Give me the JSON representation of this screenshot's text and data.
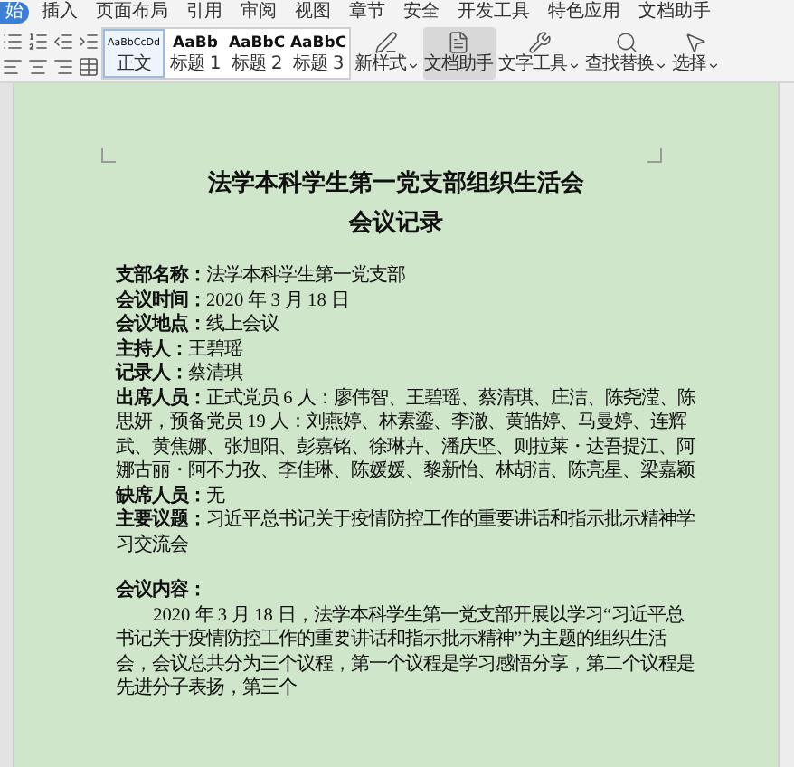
{
  "menu_tabs": [
    {
      "label": "始",
      "selected": true
    },
    {
      "label": "插入",
      "selected": false
    },
    {
      "label": "页面布局",
      "selected": false
    },
    {
      "label": "引用",
      "selected": false
    },
    {
      "label": "审阅",
      "selected": false
    },
    {
      "label": "视图",
      "selected": false
    },
    {
      "label": "章节",
      "selected": false
    },
    {
      "label": "安全",
      "selected": false
    },
    {
      "label": "开发工具",
      "selected": false
    },
    {
      "label": "特色应用",
      "selected": false
    },
    {
      "label": "文档助手",
      "selected": false
    }
  ],
  "styles": [
    {
      "sample": "AaBbCcDd",
      "label": "正文",
      "selected": true
    },
    {
      "sample": "AaBb",
      "label": "标题 1",
      "selected": false
    },
    {
      "sample": "AaBbC",
      "label": "标题 2",
      "selected": false
    },
    {
      "sample": "AaBbC",
      "label": "标题 3",
      "selected": false
    }
  ],
  "tools": [
    {
      "kind": "new-style",
      "label": "新样式",
      "dropdown": true,
      "selected": false
    },
    {
      "kind": "assistant",
      "label": "文档助手",
      "dropdown": false,
      "selected": true
    },
    {
      "kind": "text-tools",
      "label": "文字工具",
      "dropdown": true,
      "selected": false
    },
    {
      "kind": "find",
      "label": "查找替换",
      "dropdown": true,
      "selected": false
    },
    {
      "kind": "select",
      "label": "选择",
      "dropdown": true,
      "selected": false
    }
  ],
  "document": {
    "title": "法学本科学生第一党支部组织生活会",
    "subtitle": "会议记录",
    "fields": [
      {
        "label": "支部名称：",
        "value": "法学本科学生第一党支部"
      },
      {
        "label": "会议时间：",
        "value": "2020 年 3 月 18 日"
      },
      {
        "label": "会议地点：",
        "value": "线上会议"
      },
      {
        "label": "主持人：",
        "value": "王碧瑶"
      },
      {
        "label": "记录人：",
        "value": "蔡清琪"
      },
      {
        "label": "出席人员：",
        "value": "正式党员 6 人：廖伟智、王碧瑶、蔡清琪、庄洁、陈尧滢、陈思妍，预备党员 19 人：刘燕婷、林素鎏、李澈、黄皓婷、马曼婷、连辉武、黄焦娜、张旭阳、彭嘉铭、徐琳卉、潘庆坚、则拉莱・达吾提江、阿娜古丽・阿不力孜、李佳琳、陈媛媛、黎新怡、林胡洁、陈亮星、梁嘉颖"
      },
      {
        "label": "缺席人员：",
        "value": "无"
      },
      {
        "label": "主要议题：",
        "value": "习近平总书记关于疫情防控工作的重要讲话和指示批示精神学习交流会"
      }
    ],
    "content_heading": "会议内容：",
    "content": "2020 年 3 月 18 日，法学本科学生第一党支部开展以学习“习近平总书记关于疫情防控工作的重要讲话和指示批示精神”为主题的组织生活会，会议总共分为三个议程，第一个议程是学习感悟分享，第二个议程是先进分子表扬，第三个"
  }
}
